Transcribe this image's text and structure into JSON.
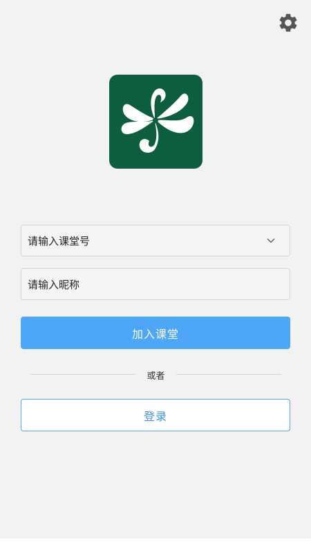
{
  "header": {
    "settings_icon": "gear-icon"
  },
  "logo": {
    "icon": "pinwheel-logo",
    "background": "#0d5e3f"
  },
  "form": {
    "classroom_placeholder": "请输入课堂号",
    "classroom_dropdown_icon": "chevron-down-icon",
    "nickname_placeholder": "请输入昵称",
    "join_label": "加入课堂",
    "divider_text": "或者",
    "login_label": "登录"
  },
  "colors": {
    "accent": "#4da6f7",
    "background": "#f2f2f2"
  }
}
